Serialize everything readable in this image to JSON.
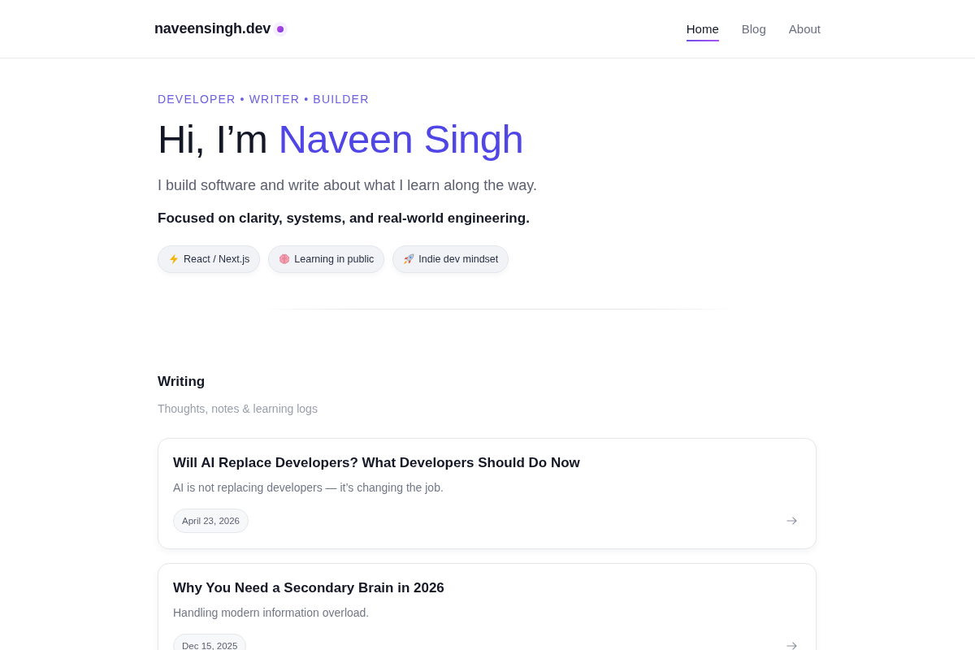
{
  "header": {
    "logo": "naveensingh.dev",
    "nav": [
      {
        "label": "Home",
        "selected": true
      },
      {
        "label": "Blog",
        "selected": false
      },
      {
        "label": "About",
        "selected": false
      }
    ]
  },
  "hero": {
    "eyebrow": "DEVELOPER • WRITER • BUILDER",
    "greeting": "Hi, I’m",
    "name": "Naveen Singh",
    "tagline": "I build software and write about what I learn along the way.",
    "focus": "Focused on clarity, systems, and real-world engineering.",
    "chips": [
      "React / Next.js",
      "Learning in public",
      "Indie dev mindset"
    ]
  },
  "writing": {
    "title": "Writing",
    "subtitle": "Thoughts, notes & learning logs",
    "posts": [
      {
        "title": "Will AI Replace Developers? What Developers Should Do Now",
        "summary": "AI is not replacing developers — it’s changing the job.",
        "date": "April 23, 2026"
      },
      {
        "title": "Why You Need a Secondary Brain in 2026",
        "summary": "Handling modern information overload.",
        "date": "Dec 15, 2025"
      }
    ]
  }
}
